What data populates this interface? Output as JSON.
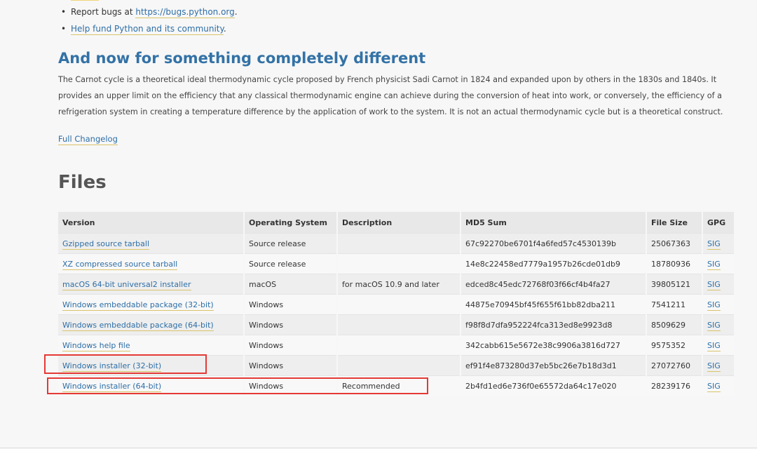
{
  "bullets": [
    {
      "prefix": "Report bugs at ",
      "link": "https://bugs.python.org",
      "suffix": "."
    },
    {
      "prefix": "",
      "link": "Help fund Python and its community",
      "suffix": "."
    }
  ],
  "section": {
    "title": "And now for something completely different",
    "paragraph": "The Carnot cycle is a theoretical ideal thermodynamic cycle proposed by French physicist Sadi Carnot in 1824 and expanded upon by others in the 1830s and 1840s. It provides an upper limit on the efficiency that any classical thermodynamic engine can achieve during the conversion of heat into work, or conversely, the efficiency of a refrigeration system in creating a temperature difference by the application of work to the system. It is not an actual thermodynamic cycle but is a theoretical construct.",
    "changelog_link": "Full Changelog"
  },
  "files": {
    "title": "Files",
    "headers": [
      "Version",
      "Operating System",
      "Description",
      "MD5 Sum",
      "File Size",
      "GPG"
    ],
    "rows": [
      {
        "version": "Gzipped source tarball",
        "os": "Source release",
        "desc": "",
        "md5": "67c92270be6701f4a6fed57c4530139b",
        "size": "25067363",
        "gpg": "SIG"
      },
      {
        "version": "XZ compressed source tarball",
        "os": "Source release",
        "desc": "",
        "md5": "14e8c22458ed7779a1957b26cde01db9",
        "size": "18780936",
        "gpg": "SIG"
      },
      {
        "version": "macOS 64-bit universal2 installer",
        "os": "macOS",
        "desc": "for macOS 10.9 and later",
        "md5": "edced8c45edc72768f03f66cf4b4fa27",
        "size": "39805121",
        "gpg": "SIG"
      },
      {
        "version": "Windows embeddable package (32-bit)",
        "os": "Windows",
        "desc": "",
        "md5": "44875e70945bf45f655f61bb82dba211",
        "size": "7541211",
        "gpg": "SIG"
      },
      {
        "version": "Windows embeddable package (64-bit)",
        "os": "Windows",
        "desc": "",
        "md5": "f98f8d7dfa952224fca313ed8e9923d8",
        "size": "8509629",
        "gpg": "SIG"
      },
      {
        "version": "Windows help file",
        "os": "Windows",
        "desc": "",
        "md5": "342cabb615e5672e38c9906a3816d727",
        "size": "9575352",
        "gpg": "SIG"
      },
      {
        "version": "Windows installer (32-bit)",
        "os": "Windows",
        "desc": "",
        "md5": "ef91f4e873280d37eb5bc26e7b18d3d1",
        "size": "27072760",
        "gpg": "SIG"
      },
      {
        "version": "Windows installer (64-bit)",
        "os": "Windows",
        "desc": "Recommended",
        "md5": "2b4fd1ed6e736f0e65572da64c17e020",
        "size": "28239176",
        "gpg": "SIG"
      }
    ]
  },
  "colors": {
    "link": "#2d6ea6",
    "heading": "#3372a6",
    "highlight": "#e53935"
  }
}
